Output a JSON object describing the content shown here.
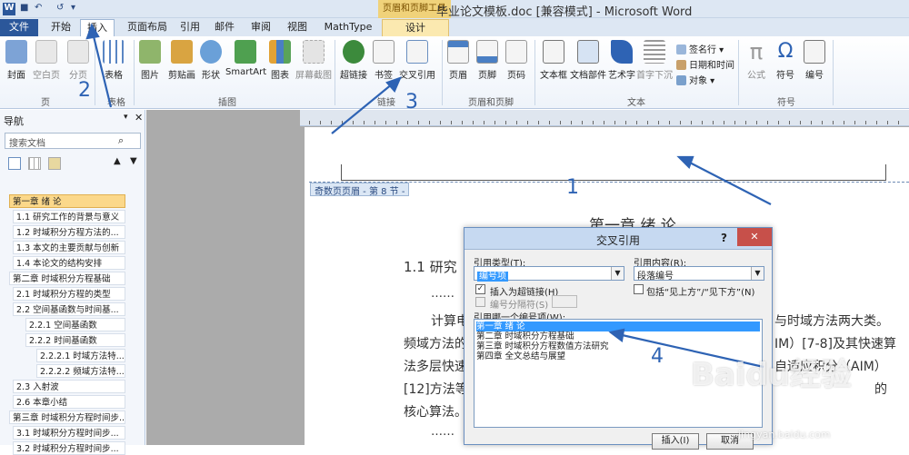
{
  "titlebar": {
    "title": "毕业论文模板.doc [兼容模式] - Microsoft Word",
    "context_group": "页眉和页脚工具",
    "app_icon": "W"
  },
  "tabs": [
    "文件",
    "开始",
    "插入",
    "页面布局",
    "引用",
    "邮件",
    "审阅",
    "视图",
    "MathType",
    "设计"
  ],
  "ribbon": {
    "page_group": {
      "label": "页",
      "buttons": [
        "封面",
        "空白页",
        "分页"
      ]
    },
    "table_group": {
      "label": "表格",
      "buttons": [
        "表格"
      ]
    },
    "illust_group": {
      "label": "插图",
      "buttons": [
        "图片",
        "剪贴画",
        "形状",
        "SmartArt",
        "图表",
        "屏幕截图"
      ]
    },
    "links_group": {
      "label": "链接",
      "buttons": [
        "超链接",
        "书签",
        "交叉引用"
      ]
    },
    "hf_group": {
      "label": "页眉和页脚",
      "buttons": [
        "页眉",
        "页脚",
        "页码"
      ]
    },
    "text_group": {
      "label": "文本",
      "buttons": [
        "文本框",
        "文档部件",
        "艺术字",
        "首字下沉"
      ],
      "small": [
        "签名行",
        "日期和时间",
        "对象"
      ]
    },
    "symbol_group": {
      "label": "符号",
      "buttons": [
        "公式",
        "符号",
        "编号"
      ]
    }
  },
  "nav": {
    "title": "导航",
    "search_placeholder": "搜索文档",
    "items": [
      "第一章 绪 论",
      "1.1 研究工作的背景与意义",
      "1.2 时域积分方程方法的...",
      "1.3 本文的主要贡献与创新",
      "1.4 本论文的结构安排",
      "第二章 时域积分方程基础",
      "2.1 时域积分方程的类型",
      "2.2 空间基函数与时间基...",
      "2.2.1 空间基函数",
      "2.2.2 时间基函数",
      "2.2.2.1 时域方法特...",
      "2.2.2.2 频域方法特...",
      "2.3 入射波",
      "2.6 本章小结",
      "第三章 时域积分方程时间步...",
      "3.1 时域积分方程时间步...",
      "3.2 时域积分方程时间步..."
    ]
  },
  "document": {
    "header_tag": "奇数页页眉 - 第 8 节 -",
    "chapter_title": "第一章   绪 论",
    "section": "1.1  研究",
    "dots1": "……",
    "line1": "计算电",
    "line1_right": "与时域方法两大类。",
    "line2": "频域方法的",
    "line2_right": "IM）[7-8]及其快速算",
    "line3": "法多层快速",
    "line3_right": "自适应积分（AIM）",
    "line4": "[12]方法等。",
    "line4_right": "的",
    "line5": "核心算法。",
    "dots2": "……"
  },
  "dialog": {
    "title": "交叉引用",
    "help": "?",
    "close": "✕",
    "ref_type_label": "引用类型(T):",
    "ref_type_value": "编号项",
    "ref_content_label": "引用内容(R):",
    "ref_content_value": "段落编号",
    "hyperlink_label": "插入为超链接(H)",
    "above_below_label": "包括“见上方”/“见下方”(N)",
    "separator_label": "编号分隔符(S)",
    "list_label": "引用哪一个编号项(W):",
    "list_items": [
      "第一章 绪 论",
      "第二章 时域积分方程基础",
      "第三章 时域积分方程数值方法研究",
      "第四章 全文总结与展望"
    ],
    "insert_button": "插入(I)",
    "cancel_button": "取消"
  },
  "annotations": [
    "1",
    "2",
    "3",
    "4"
  ],
  "watermark": {
    "brand": "Baidu经验",
    "url": "jingyan.baidu.com"
  },
  "colors": {
    "accent": "#2b579a",
    "selection": "#3399ff",
    "annotation": "#2e63b4",
    "context": "#f0d27a"
  }
}
